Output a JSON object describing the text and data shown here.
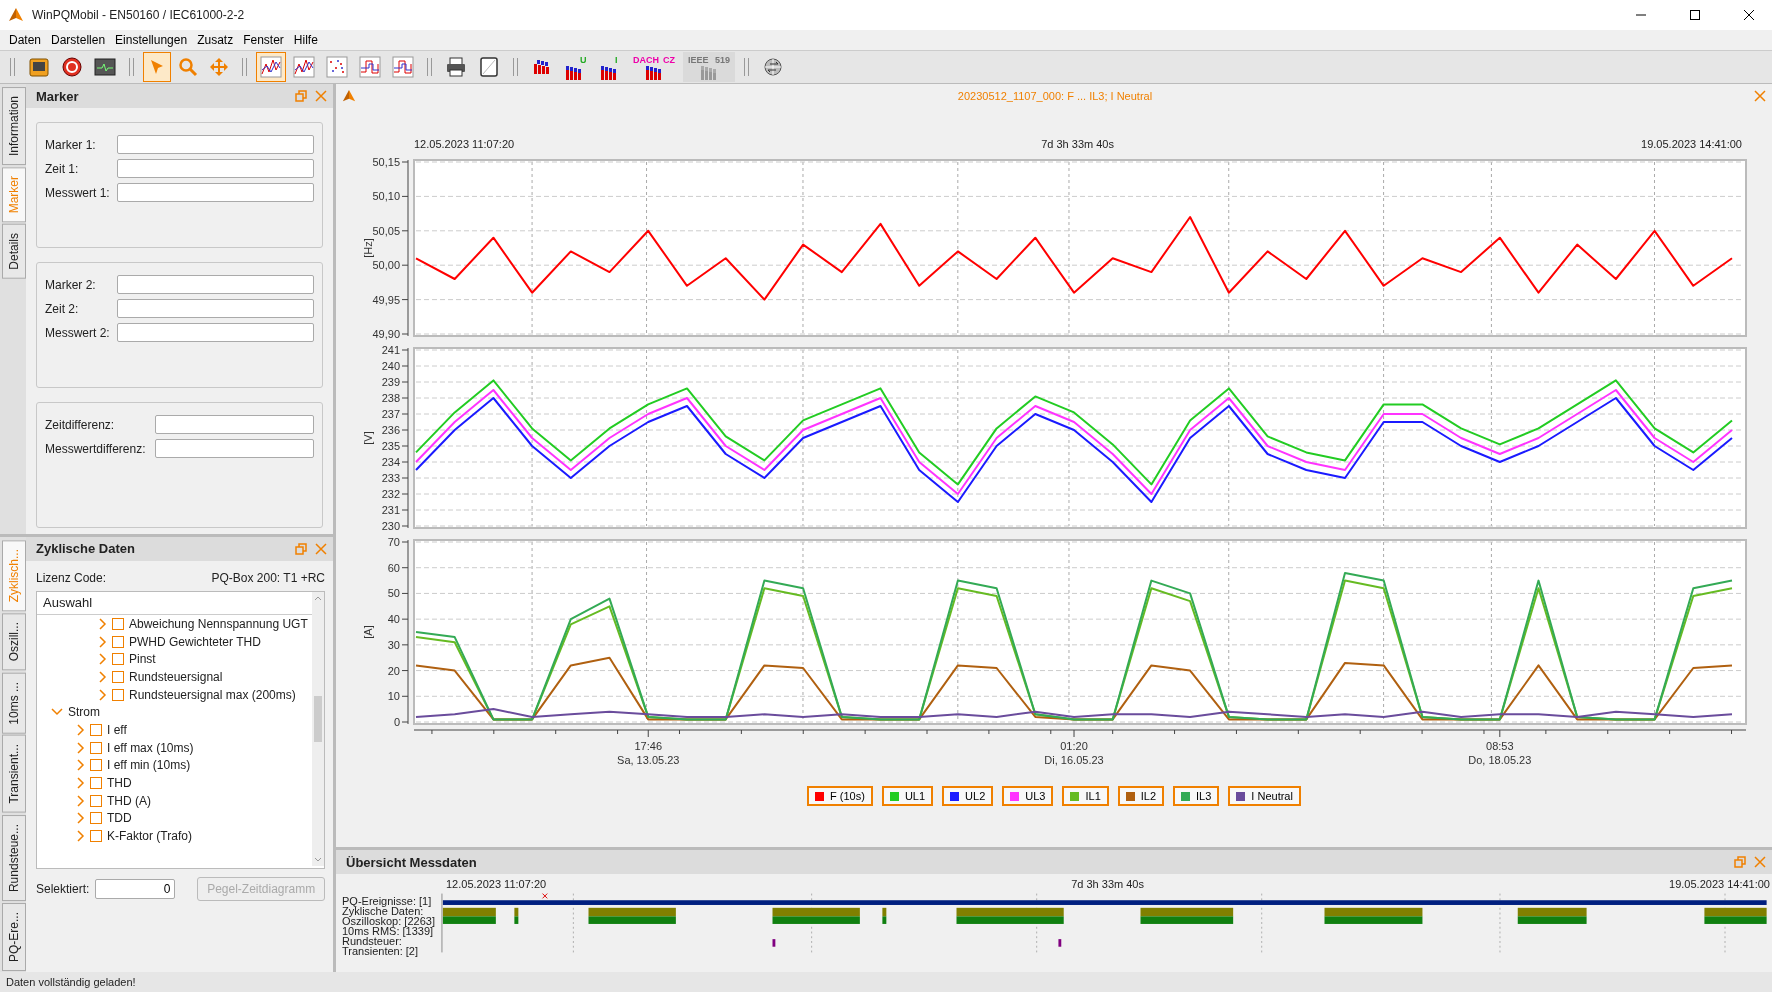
{
  "window": {
    "title": "WinPQMobil - EN50160 / IEC61000-2-2"
  },
  "menu": [
    "Daten",
    "Darstellen",
    "Einstellungen",
    "Zusatz",
    "Fenster",
    "Hilfe"
  ],
  "toolbar": [
    {
      "kind": "device",
      "selected": false,
      "disabled": false
    },
    {
      "kind": "refresh",
      "selected": false,
      "disabled": false
    },
    {
      "kind": "monitor",
      "selected": false,
      "disabled": false
    },
    {
      "kind": "separator"
    },
    {
      "kind": "pointer",
      "selected": true,
      "disabled": false
    },
    {
      "kind": "zoom",
      "selected": false,
      "disabled": false
    },
    {
      "kind": "pan",
      "selected": false,
      "disabled": false
    },
    {
      "kind": "separator"
    },
    {
      "kind": "line-chart",
      "selected": true,
      "disabled": false
    },
    {
      "kind": "line-chart",
      "selected": false,
      "disabled": false
    },
    {
      "kind": "scatter-chart",
      "selected": false,
      "disabled": false
    },
    {
      "kind": "step-chart",
      "selected": false,
      "disabled": false
    },
    {
      "kind": "step-chart",
      "selected": false,
      "disabled": false
    },
    {
      "kind": "separator"
    },
    {
      "kind": "printer",
      "selected": false,
      "disabled": false
    },
    {
      "kind": "page",
      "selected": false,
      "disabled": false
    },
    {
      "kind": "separator"
    },
    {
      "kind": "bar-chart",
      "selected": false,
      "disabled": false
    },
    {
      "kind": "bar-chart",
      "selected": false,
      "disabled": false,
      "caption": "U"
    },
    {
      "kind": "bar-chart",
      "selected": false,
      "disabled": false,
      "caption": "I"
    },
    {
      "kind": "bar-chart",
      "selected": false,
      "disabled": false,
      "caption": "DACH",
      "caption2": "CZ"
    },
    {
      "kind": "bar-chart",
      "selected": false,
      "disabled": true,
      "caption": "IEEE",
      "caption2": "519"
    },
    {
      "kind": "separator"
    },
    {
      "kind": "globe",
      "selected": false,
      "disabled": false
    }
  ],
  "marker_dock": {
    "tabs": [
      {
        "label": "Information",
        "selected": false
      },
      {
        "label": "Marker",
        "selected": true
      },
      {
        "label": "Details",
        "selected": false
      }
    ],
    "title": "Marker",
    "groups": [
      [
        "Marker 1:",
        "Zeit 1:",
        "Messwert 1:"
      ],
      [
        "Marker 2:",
        "Zeit 2:",
        "Messwert 2:"
      ],
      [
        "Zeitdifferenz:",
        "Messwertdifferenz:"
      ]
    ]
  },
  "cyclic_dock": {
    "tabs": [
      {
        "label": "Zyklisch...",
        "selected": true
      },
      {
        "label": "Oszill...",
        "selected": false
      },
      {
        "label": "10ms ...",
        "selected": false
      },
      {
        "label": "Transient...",
        "selected": false
      },
      {
        "label": "Rundsteue...",
        "selected": false
      },
      {
        "label": "PQ-Ere...",
        "selected": false
      }
    ],
    "title": "Zyklische Daten",
    "license_label": "Lizenz Code:",
    "license_value": "PQ-Box 200: T1 +RC",
    "tree_header": "Auswahl",
    "tree": [
      {
        "children": [
          {
            "label": "Abweichung Nennspannung UGT",
            "expanded": false,
            "checked": false
          },
          {
            "label": "PWHD Gewichteter THD",
            "expanded": false,
            "checked": false
          },
          {
            "label": "Pinst",
            "expanded": false,
            "checked": false
          },
          {
            "label": "Rundsteuersignal",
            "expanded": false,
            "checked": false
          },
          {
            "label": "Rundsteuersignal max (200ms)",
            "expanded": false,
            "checked": false
          }
        ]
      },
      {
        "label": "Strom",
        "expanded": true,
        "children": [
          {
            "label": "I eff",
            "expanded": false,
            "checked": false
          },
          {
            "label": "I eff max (10ms)",
            "expanded": false,
            "checked": false
          },
          {
            "label": "I eff min (10ms)",
            "expanded": false,
            "checked": false
          },
          {
            "label": "THD",
            "expanded": false,
            "checked": false
          },
          {
            "label": "THD (A)",
            "expanded": false,
            "checked": false
          },
          {
            "label": "TDD",
            "expanded": false,
            "checked": false
          },
          {
            "label": "K-Faktor (Trafo)",
            "expanded": false,
            "checked": false
          }
        ]
      }
    ],
    "selected_label": "Selektiert:",
    "selected_value": "0",
    "action_button": {
      "label": "Pegel-Zeitdiagramm",
      "disabled": true
    }
  },
  "chart_panel": {
    "title": "20230512_1107_000: F  ...  IL3; I Neutral",
    "range_start": "12.05.2023 11:07:20",
    "duration": "7d 3h 33m 40s",
    "range_end": "19.05.2023 14:41:00",
    "plots": [
      {
        "chart_data": {
          "type": "line",
          "grid": true,
          "ylabel": "[Hz]",
          "ylim": [
            49.9,
            50.15
          ],
          "yticks": [
            {
              "value": 49.9,
              "label": "49,90"
            },
            {
              "value": 49.95,
              "label": "49,95"
            },
            {
              "value": 50.0,
              "label": "50,00"
            },
            {
              "value": 50.05,
              "label": "50,05"
            },
            {
              "value": 50.1,
              "label": "50,10"
            },
            {
              "value": 50.15,
              "label": "50,15"
            }
          ],
          "series": [
            {
              "name": "F (10s)",
              "color": "#ff0000",
              "values": [
                50.01,
                49.98,
                50.04,
                49.96,
                50.02,
                49.99,
                50.05,
                49.97,
                50.01,
                49.95,
                50.03,
                49.99,
                50.06,
                49.97,
                50.02,
                49.98,
                50.04,
                49.96,
                50.01,
                49.99,
                50.07,
                49.96,
                50.02,
                49.98,
                50.05,
                49.97,
                50.01,
                49.99,
                50.04,
                49.96,
                50.03,
                49.98,
                50.05,
                49.97,
                50.01
              ]
            }
          ]
        }
      },
      {
        "chart_data": {
          "type": "line",
          "grid": true,
          "ylabel": "[V]",
          "ylim": [
            230,
            241
          ],
          "yticks": [
            230,
            231,
            232,
            233,
            234,
            235,
            236,
            237,
            238,
            239,
            240,
            241
          ],
          "series": [
            {
              "name": "UL1",
              "color": "#22cc22",
              "values": [
                234.6,
                237.1,
                239.1,
                236.1,
                234.1,
                236.1,
                237.6,
                238.6,
                235.6,
                234.1,
                236.6,
                237.6,
                238.6,
                234.6,
                232.6,
                236.1,
                238.1,
                237.1,
                235.1,
                232.6,
                236.6,
                238.6,
                235.6,
                234.6,
                234.1,
                237.6,
                237.6,
                236.1,
                235.1,
                236.1,
                237.6,
                239.1,
                236.1,
                234.6,
                236.6
              ]
            },
            {
              "name": "UL2",
              "color": "#1a1aff",
              "values": [
                233.5,
                236,
                238,
                235,
                233,
                235,
                236.5,
                237.5,
                234.5,
                233,
                235.5,
                236.5,
                237.5,
                233.5,
                231.5,
                235,
                237,
                236,
                234,
                231.5,
                235.5,
                237.5,
                234.5,
                233.5,
                233,
                236.5,
                236.5,
                235,
                234,
                235,
                236.5,
                238,
                235,
                233.5,
                235.5
              ]
            },
            {
              "name": "UL3",
              "color": "#ff33ff",
              "values": [
                234,
                236.5,
                238.5,
                235.5,
                233.5,
                235.5,
                237,
                238,
                235,
                233.5,
                236,
                237,
                238,
                234,
                232,
                235.5,
                237.5,
                236.5,
                234.5,
                232,
                236,
                238,
                235,
                234,
                233.5,
                237,
                237,
                235.5,
                234.5,
                235.5,
                237,
                238.5,
                235.5,
                234,
                236
              ]
            }
          ]
        }
      },
      {
        "chart_data": {
          "type": "line",
          "grid": true,
          "ylabel": "[A]",
          "ylim": [
            0,
            70
          ],
          "yticks": [
            0,
            10,
            20,
            30,
            40,
            50,
            60,
            70
          ],
          "categories": [
            null,
            null,
            null,
            null,
            null,
            null,
            "17:46\nSa, 13.05.23",
            null,
            null,
            null,
            null,
            null,
            null,
            null,
            null,
            null,
            null,
            "01:20\nDi, 16.05.23",
            null,
            null,
            null,
            null,
            null,
            null,
            null,
            null,
            null,
            null,
            "08:53\nDo, 18.05.23",
            null,
            null,
            null,
            null,
            null,
            null
          ],
          "series": [
            {
              "name": "IL1",
              "color": "#66bb22",
              "values": [
                33,
                31,
                1,
                1,
                38,
                45,
                2,
                1,
                1,
                52,
                49,
                2,
                1,
                1,
                52,
                49,
                3,
                1,
                1,
                52,
                47,
                2,
                1,
                1,
                55,
                52,
                2,
                1,
                1,
                52,
                2,
                1,
                1,
                49,
                52
              ]
            },
            {
              "name": "IL2",
              "color": "#b06010",
              "values": [
                22,
                20,
                1,
                1,
                22,
                25,
                1,
                1,
                1,
                22,
                21,
                1,
                1,
                1,
                22,
                21,
                2,
                1,
                1,
                22,
                20,
                1,
                1,
                1,
                23,
                22,
                1,
                1,
                1,
                22,
                1,
                1,
                1,
                21,
                22
              ]
            },
            {
              "name": "IL3",
              "color": "#33aa55",
              "values": [
                35,
                33,
                1,
                1,
                40,
                48,
                2,
                1,
                1,
                55,
                52,
                2,
                1,
                1,
                55,
                52,
                3,
                1,
                1,
                55,
                50,
                2,
                1,
                1,
                58,
                55,
                2,
                1,
                1,
                55,
                2,
                1,
                1,
                52,
                55
              ]
            },
            {
              "name": "I Neutral",
              "color": "#6a4c9c",
              "values": [
                2,
                3,
                5,
                2,
                3,
                4,
                3,
                2,
                2,
                3,
                2,
                3,
                2,
                2,
                3,
                2,
                4,
                2,
                3,
                3,
                2,
                4,
                3,
                2,
                3,
                2,
                4,
                2,
                3,
                3,
                2,
                4,
                3,
                2,
                3
              ]
            }
          ]
        }
      }
    ]
  },
  "overview": {
    "title": "Übersicht Messdaten",
    "range_start": "12.05.2023 11:07:20",
    "duration": "7d 3h 33m 40s",
    "range_end": "19.05.2023 14:41:00",
    "rows": [
      "PQ-Ereignisse: [1]",
      "Zyklische Daten:",
      "Oszilloskop: [2263]",
      "10ms RMS: [1339]",
      "Rundsteuer:",
      "Transienten: [2]"
    ]
  },
  "status_bar": "Daten vollständig geladen!"
}
